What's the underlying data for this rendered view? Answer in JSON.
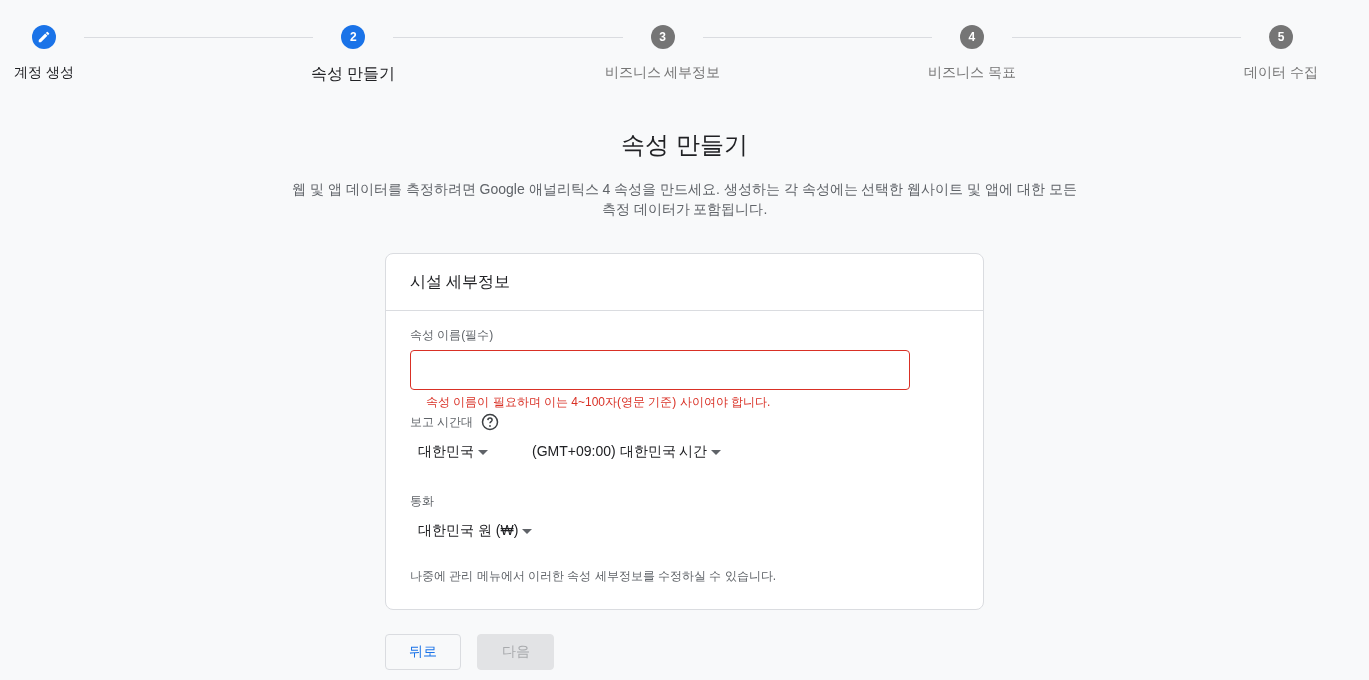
{
  "stepper": {
    "steps": [
      {
        "label": "계정 생성",
        "completed": true,
        "selected": false
      },
      {
        "number": "2",
        "label": "속성 만들기",
        "completed": false,
        "selected": true
      },
      {
        "number": "3",
        "label": "비즈니스 세부정보",
        "completed": false,
        "selected": false
      },
      {
        "number": "4",
        "label": "비즈니스 목표",
        "completed": false,
        "selected": false
      },
      {
        "number": "5",
        "label": "데이터 수집",
        "completed": false,
        "selected": false
      }
    ]
  },
  "heading": "속성 만들기",
  "description": "웹 및 앱 데이터를 측정하려면 Google 애널리틱스 4 속성을 만드세요. 생성하는 각 속성에는 선택한 웹사이트 및 앱에 대한 모든 측정 데이터가 포함됩니다.",
  "card": {
    "title": "시설 세부정보",
    "property_name": {
      "label": "속성 이름(필수)",
      "invalid": true,
      "error": "속성 이름이 필요하며 이는 4~100자(영문 기준) 사이여야 합니다."
    },
    "timezone": {
      "label": "보고 시간대",
      "selects": [
        "대한민국",
        "(GMT+09:00) 대한민국 시간"
      ]
    },
    "currency": {
      "label": "통화",
      "selects": [
        "대한민국 원 (₩)"
      ]
    },
    "note": "나중에 관리 메뉴에서 이러한 속성 세부정보를 수정하실 수 있습니다."
  },
  "buttons": [
    {
      "label": "뒤로",
      "disabled": false
    },
    {
      "label": "다음",
      "disabled": true
    }
  ]
}
